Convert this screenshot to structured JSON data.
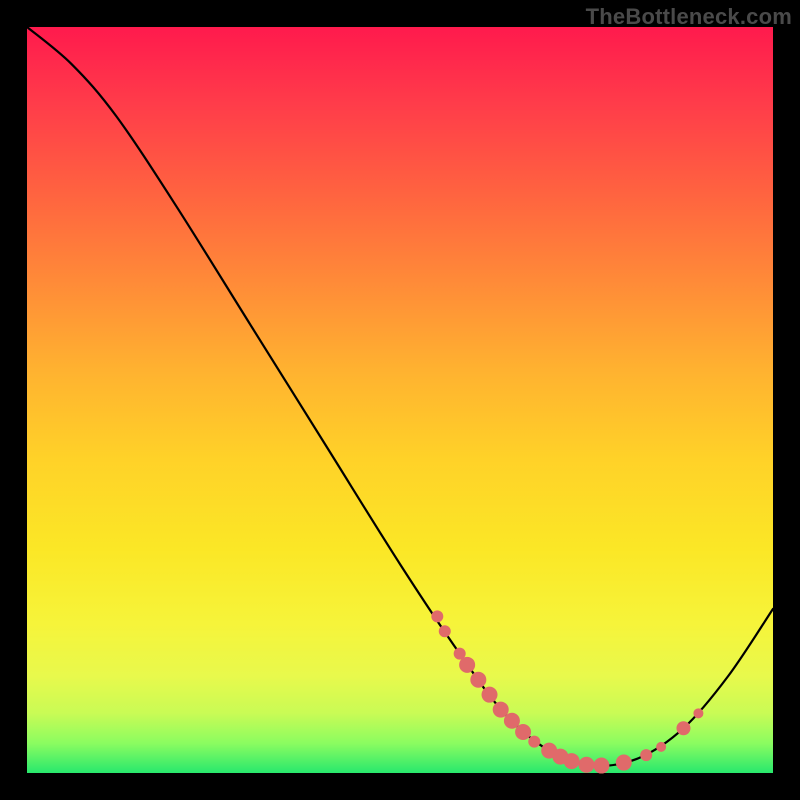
{
  "watermark": "TheBottleneck.com",
  "colors": {
    "curve_stroke": "#000000",
    "marker_fill": "#e06a6a",
    "marker_stroke": "#c94f4f"
  },
  "chart_data": {
    "type": "line",
    "title": "",
    "xlabel": "",
    "ylabel": "",
    "xlim": [
      0,
      100
    ],
    "ylim": [
      0,
      100
    ],
    "curve_points": [
      {
        "x": 0,
        "y": 100
      },
      {
        "x": 6,
        "y": 95
      },
      {
        "x": 12,
        "y": 88
      },
      {
        "x": 20,
        "y": 76
      },
      {
        "x": 30,
        "y": 60
      },
      {
        "x": 40,
        "y": 44
      },
      {
        "x": 50,
        "y": 28
      },
      {
        "x": 58,
        "y": 16
      },
      {
        "x": 64,
        "y": 8
      },
      {
        "x": 70,
        "y": 3
      },
      {
        "x": 76,
        "y": 1
      },
      {
        "x": 82,
        "y": 2
      },
      {
        "x": 88,
        "y": 6
      },
      {
        "x": 94,
        "y": 13
      },
      {
        "x": 100,
        "y": 22
      }
    ],
    "markers": [
      {
        "x": 55,
        "y": 21,
        "r": 6
      },
      {
        "x": 56,
        "y": 19,
        "r": 6
      },
      {
        "x": 58,
        "y": 16,
        "r": 6
      },
      {
        "x": 59,
        "y": 14.5,
        "r": 8
      },
      {
        "x": 60.5,
        "y": 12.5,
        "r": 8
      },
      {
        "x": 62,
        "y": 10.5,
        "r": 8
      },
      {
        "x": 63.5,
        "y": 8.5,
        "r": 8
      },
      {
        "x": 65,
        "y": 7,
        "r": 8
      },
      {
        "x": 66.5,
        "y": 5.5,
        "r": 8
      },
      {
        "x": 68,
        "y": 4.2,
        "r": 6
      },
      {
        "x": 70,
        "y": 3,
        "r": 8
      },
      {
        "x": 71.5,
        "y": 2.2,
        "r": 8
      },
      {
        "x": 73,
        "y": 1.6,
        "r": 8
      },
      {
        "x": 75,
        "y": 1.1,
        "r": 8
      },
      {
        "x": 77,
        "y": 1.0,
        "r": 8
      },
      {
        "x": 80,
        "y": 1.4,
        "r": 8
      },
      {
        "x": 83,
        "y": 2.4,
        "r": 6
      },
      {
        "x": 85,
        "y": 3.5,
        "r": 5
      },
      {
        "x": 88,
        "y": 6.0,
        "r": 7
      },
      {
        "x": 90,
        "y": 8.0,
        "r": 5
      }
    ]
  }
}
